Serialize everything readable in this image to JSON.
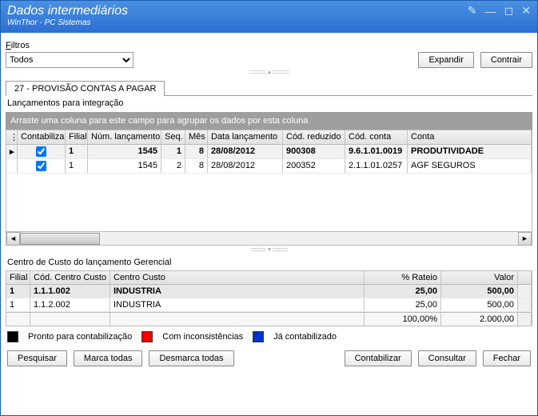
{
  "titlebar": {
    "title": "Dados intermediários",
    "subtitle": "WinThor - PC Sistemas"
  },
  "filtros": {
    "label_pre": "F",
    "label_rest": "iltros",
    "value": "Todos"
  },
  "buttons": {
    "expandir": "Expandir",
    "contrair": "Contrair",
    "pesquisar": "Pesquisar",
    "marca": "Marca todas",
    "desmarca": "Desmarca todas",
    "contabilizar": "Contabilizar",
    "consultar": "Consultar",
    "fechar": "Fechar"
  },
  "tab": {
    "label": "27 - PROVISÃO CONTAS A PAGAR"
  },
  "sub_header": "Lançamentos para integração",
  "group_hint": "Arraste uma coluna para este campo para agrupar os dados por esta coluna",
  "grid": {
    "headers": {
      "contab": "Contabilizar",
      "filial": "Filial",
      "num": "Núm. lançamento",
      "seq": "Seq.",
      "mes": "Mês",
      "data": "Data lançamento",
      "red": "Cód. reduzido",
      "cod": "Cód. conta",
      "conta": "Conta"
    },
    "rows": [
      {
        "sel": true,
        "check": true,
        "filial": "1",
        "num": "1545",
        "seq": "1",
        "mes": "8",
        "data": "28/08/2012",
        "red": "900308",
        "cod": "9.6.1.01.0019",
        "conta": "PRODUTIVIDADE"
      },
      {
        "sel": false,
        "check": true,
        "filial": "1",
        "num": "1545",
        "seq": "2",
        "mes": "8",
        "data": "28/08/2012",
        "red": "200352",
        "cod": "2.1.1.01.0257",
        "conta": "AGF SEGUROS"
      }
    ]
  },
  "cc_section": "Centro de Custo do lançamento Gerencial",
  "cc_grid": {
    "headers": {
      "filial": "Filial",
      "cod": "Cód. Centro Custo",
      "centro": "Centro Custo",
      "rateio": "% Rateio",
      "valor": "Valor"
    },
    "rows": [
      {
        "sel": true,
        "filial": "1",
        "cod": "1.1.1.002",
        "centro": "INDUSTRIA",
        "rateio": "25,00",
        "valor": "500,00"
      },
      {
        "sel": false,
        "filial": "1",
        "cod": "1.1.2.002",
        "centro": "INDUSTRIA",
        "rateio": "25,00",
        "valor": "500,00"
      }
    ],
    "totals": {
      "rateio": "100,00%",
      "valor": "2.000,00"
    }
  },
  "legend": {
    "items": [
      {
        "color": "#000000",
        "label": "Pronto para contabilização"
      },
      {
        "color": "#ff0000",
        "label": "Com inconsistências"
      },
      {
        "color": "#0033cc",
        "label": "Já contabilizado"
      }
    ]
  }
}
